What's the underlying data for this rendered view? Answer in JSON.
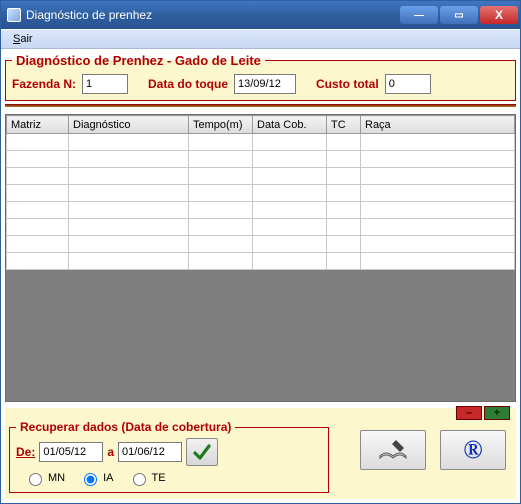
{
  "window": {
    "title": "Diagnóstico de prenhez",
    "menu": {
      "sair": "Sair"
    },
    "min": "—",
    "max": "▭",
    "close": "X"
  },
  "panel": {
    "legend": "Diagnóstico de Prenhez - Gado de Leite",
    "fazenda_label": "Fazenda N:",
    "fazenda_value": "1",
    "data_toque_label": "Data do toque",
    "data_toque_value": "13/09/12",
    "custo_label": "Custo total",
    "custo_value": "0"
  },
  "grid": {
    "columns": [
      "Matriz",
      "Diagnóstico",
      "Tempo(m)",
      "Data Cob.",
      "TC",
      "Raça"
    ],
    "rows": [
      [
        "",
        "",
        "",
        "",
        "",
        ""
      ],
      [
        "",
        "",
        "",
        "",
        "",
        ""
      ],
      [
        "",
        "",
        "",
        "",
        "",
        ""
      ],
      [
        "",
        "",
        "",
        "",
        "",
        ""
      ],
      [
        "",
        "",
        "",
        "",
        "",
        ""
      ],
      [
        "",
        "",
        "",
        "",
        "",
        ""
      ],
      [
        "",
        "",
        "",
        "",
        "",
        ""
      ],
      [
        "",
        "",
        "",
        "",
        "",
        ""
      ]
    ]
  },
  "recover": {
    "legend": "Recuperar dados (Data de cobertura)",
    "de_label": "De:",
    "de_value": "01/05/12",
    "a_label": "a",
    "a_value": "01/06/12",
    "opt_mn": "MN",
    "opt_ia": "IA",
    "opt_te": "TE"
  },
  "buttons": {
    "minus": "–",
    "plus": "+",
    "check": "✔",
    "book": "📖",
    "reg": "®"
  }
}
